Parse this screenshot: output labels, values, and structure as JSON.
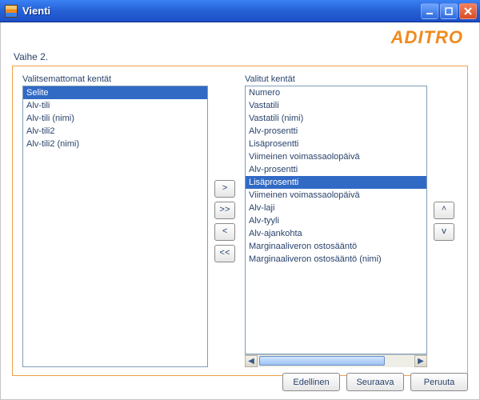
{
  "window": {
    "title": "Vienti"
  },
  "brand": "ADITRO",
  "step_label": "Vaihe 2.",
  "labels": {
    "left": "Valitsemattomat kentät",
    "right": "Valitut kentät"
  },
  "unselected": {
    "items": [
      "Selite",
      "Alv-tili",
      "Alv-tili (nimi)",
      "Alv-tili2",
      "Alv-tili2 (nimi)"
    ],
    "selected_indices": [
      0
    ]
  },
  "selected": {
    "items": [
      "Numero",
      "Vastatili",
      "Vastatili (nimi)",
      "Alv-prosentti",
      "Lisäprosentti",
      "Viimeinen voimassaolopäivä",
      "Alv-prosentti",
      "Lisäprosentti",
      "Viimeinen voimassaolopäivä",
      "Alv-laji",
      "Alv-tyyli",
      "Alv-ajankohta",
      "Marginaaliveron ostosääntö",
      "Marginaaliveron ostosääntö (nimi)"
    ],
    "selected_indices": [
      7
    ]
  },
  "mover": {
    "add": ">",
    "add_all": ">>",
    "remove": "<",
    "remove_all": "<<"
  },
  "order": {
    "up": "^",
    "down": "v"
  },
  "buttons": {
    "prev": "Edellinen",
    "next": "Seuraava",
    "cancel": "Peruuta"
  }
}
